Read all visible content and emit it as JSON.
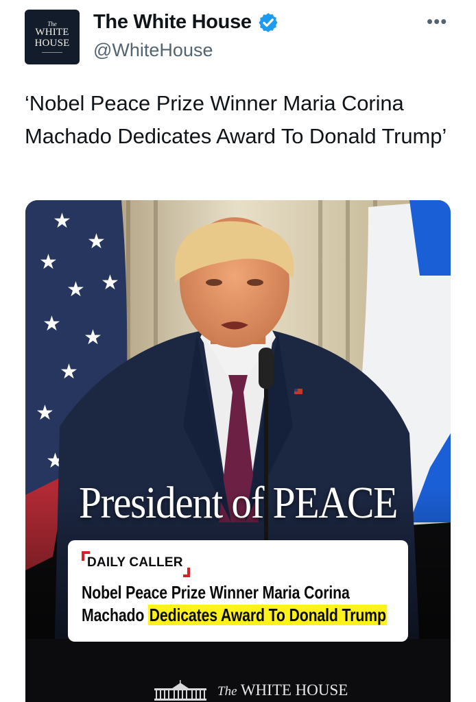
{
  "account": {
    "avatar": {
      "the": "The",
      "line1": "WHITE",
      "line2": "HOUSE"
    },
    "display_name": "The White House",
    "handle": "@WhiteHouse",
    "verified_icon": "verified-badge-icon",
    "more_icon": "more-options-icon",
    "more_glyph": "•••"
  },
  "tweet": {
    "text": "‘Nobel Peace Prize Winner Maria Corina Machado Dedicates Award To Donald Trump’"
  },
  "media": {
    "overlay_title": "President of PEACE",
    "news_card": {
      "brand": "DAILY CALLER",
      "headline_plain": "Nobel Peace Prize Winner Maria Corina Machado ",
      "headline_highlight": "Dedicates Award To Donald Trump",
      "highlight_color": "#fff21a",
      "brand_color": "#d6202b"
    },
    "footer": {
      "the": "The",
      "name": "WHITE HOUSE"
    }
  },
  "colors": {
    "verified": "#1d9bf0",
    "handle": "#536471",
    "text": "#0f1419"
  }
}
